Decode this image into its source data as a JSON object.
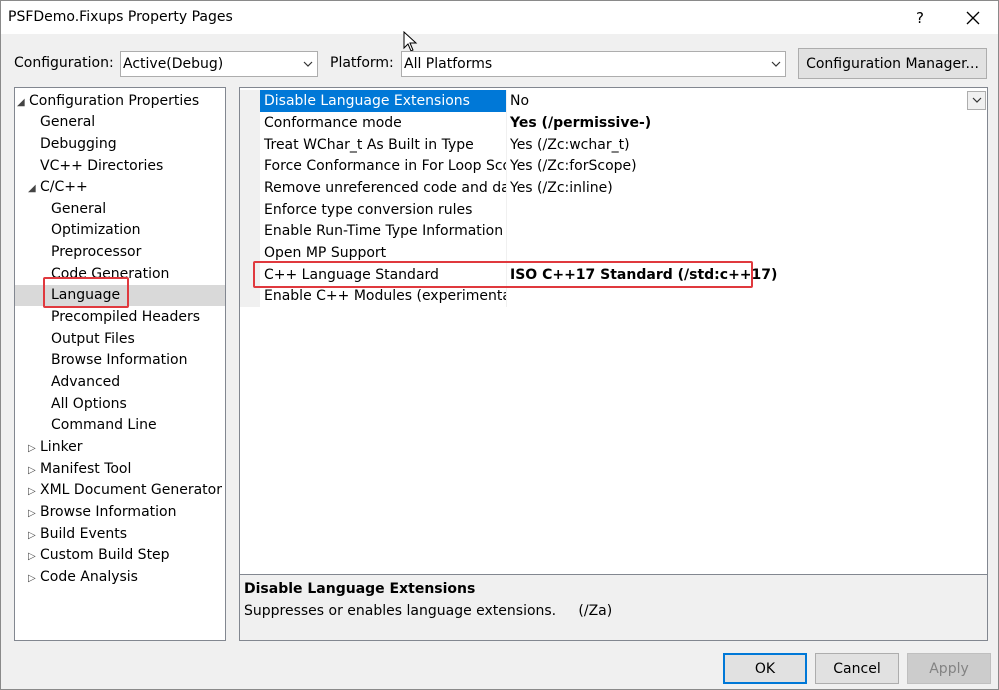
{
  "window": {
    "title": "PSFDemo.Fixups Property Pages",
    "help_label": "?"
  },
  "toolbar": {
    "configuration_label": "Configuration:",
    "configuration_value": "Active(Debug)",
    "platform_label": "Platform:",
    "platform_value": "All Platforms",
    "config_manager_label": "Configuration Manager..."
  },
  "tree": {
    "items": [
      {
        "label": "Configuration Properties",
        "expander": "◢"
      },
      {
        "label": "General"
      },
      {
        "label": "Debugging"
      },
      {
        "label": "VC++ Directories"
      },
      {
        "label": "C/C++",
        "expander": "◢"
      },
      {
        "label": "General"
      },
      {
        "label": "Optimization"
      },
      {
        "label": "Preprocessor"
      },
      {
        "label": "Code Generation"
      },
      {
        "label": "Language"
      },
      {
        "label": "Precompiled Headers"
      },
      {
        "label": "Output Files"
      },
      {
        "label": "Browse Information"
      },
      {
        "label": "Advanced"
      },
      {
        "label": "All Options"
      },
      {
        "label": "Command Line"
      },
      {
        "label": "Linker",
        "expander": "▷"
      },
      {
        "label": "Manifest Tool",
        "expander": "▷"
      },
      {
        "label": "XML Document Generator",
        "expander": "▷"
      },
      {
        "label": "Browse Information",
        "expander": "▷"
      },
      {
        "label": "Build Events",
        "expander": "▷"
      },
      {
        "label": "Custom Build Step",
        "expander": "▷"
      },
      {
        "label": "Code Analysis",
        "expander": "▷"
      }
    ]
  },
  "grid": {
    "rows": [
      {
        "name": "Disable Language Extensions",
        "value": "No"
      },
      {
        "name": "Conformance mode",
        "value": "Yes (/permissive-)"
      },
      {
        "name": "Treat WChar_t As Built in Type",
        "value": "Yes (/Zc:wchar_t)"
      },
      {
        "name": "Force Conformance in For Loop Scope",
        "value": "Yes (/Zc:forScope)"
      },
      {
        "name": "Remove unreferenced code and data",
        "value": "Yes (/Zc:inline)"
      },
      {
        "name": "Enforce type conversion rules",
        "value": ""
      },
      {
        "name": "Enable Run-Time Type Information",
        "value": ""
      },
      {
        "name": "Open MP Support",
        "value": ""
      },
      {
        "name": "C++ Language Standard",
        "value": "ISO C++17 Standard (/std:c++17)"
      },
      {
        "name": "Enable C++ Modules (experimental)",
        "value": ""
      }
    ]
  },
  "description": {
    "title": "Disable Language Extensions",
    "text": "Suppresses or enables language extensions.     (/Za)"
  },
  "buttons": {
    "ok": "OK",
    "cancel": "Cancel",
    "apply": "Apply"
  },
  "colors": {
    "selection": "#0078d7",
    "highlight_box": "#e0393e",
    "tree_selection": "#d9d9d9"
  }
}
